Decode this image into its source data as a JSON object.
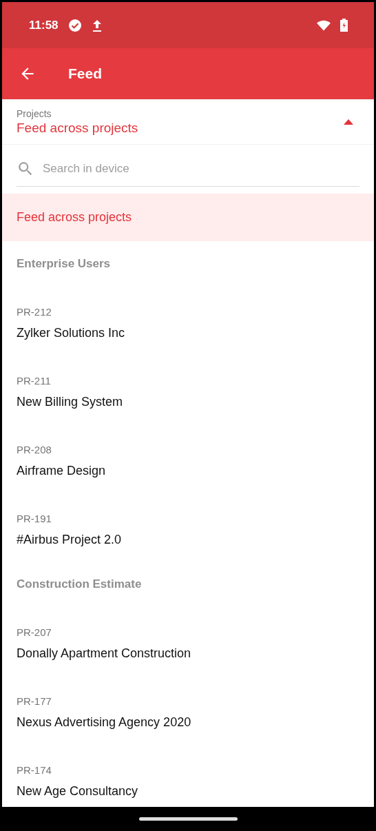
{
  "status_bar": {
    "time": "11:58"
  },
  "app_bar": {
    "title": "Feed"
  },
  "project_picker": {
    "label": "Projects",
    "value": "Feed across projects",
    "expanded": true
  },
  "search": {
    "placeholder": "Search in device"
  },
  "list": [
    {
      "kind": "option",
      "title": "Feed across projects",
      "selected": true
    },
    {
      "kind": "group",
      "title": "Enterprise Users"
    },
    {
      "kind": "project",
      "code": "PR-212",
      "title": "Zylker Solutions Inc",
      "selected": false
    },
    {
      "kind": "project",
      "code": "PR-211",
      "title": "New Billing System",
      "selected": false
    },
    {
      "kind": "project",
      "code": "PR-208",
      "title": "Airframe Design",
      "selected": false
    },
    {
      "kind": "project",
      "code": "PR-191",
      "title": "#Airbus Project 2.0",
      "selected": false
    },
    {
      "kind": "group",
      "title": "Construction Estimate"
    },
    {
      "kind": "project",
      "code": "PR-207",
      "title": "Donally Apartment Construction",
      "selected": false
    },
    {
      "kind": "project",
      "code": "PR-177",
      "title": "Nexus Advertising Agency 2020",
      "selected": false
    },
    {
      "kind": "project",
      "code": "PR-174",
      "title": "New Age Consultancy",
      "selected": false
    }
  ]
}
